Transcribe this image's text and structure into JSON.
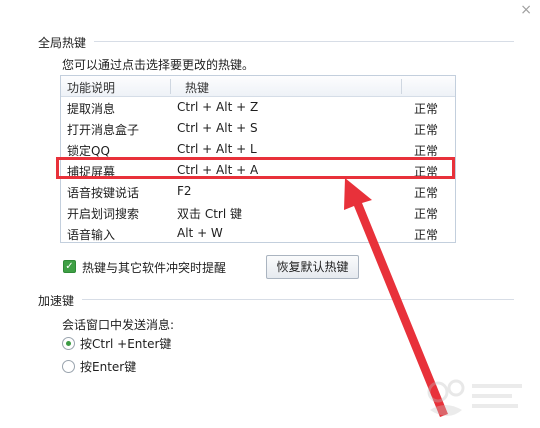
{
  "window": {
    "close_glyph": "×"
  },
  "sections": {
    "global_hotkeys": "全局热键",
    "accelerator_keys": "加速键"
  },
  "hint_text": "您可以通过点击选择要更改的热键。",
  "table": {
    "headers": [
      "功能说明",
      "热键",
      ""
    ],
    "rows": [
      {
        "name": "提取消息",
        "key": "Ctrl + Alt + Z",
        "status": "正常"
      },
      {
        "name": "打开消息盒子",
        "key": "Ctrl + Alt + S",
        "status": "正常"
      },
      {
        "name": "锁定QQ",
        "key": "Ctrl + Alt + L",
        "status": "正常"
      },
      {
        "name": "捕捉屏幕",
        "key": "Ctrl + Alt + A",
        "status": "正常"
      },
      {
        "name": "语音按键说话",
        "key": "F2",
        "status": "正常"
      },
      {
        "name": "开启划词搜索",
        "key": "双击 Ctrl 键",
        "status": "正常"
      },
      {
        "name": "语音输入",
        "key": "Alt + W",
        "status": "正常"
      }
    ],
    "highlighted_row_index": 3
  },
  "conflict_checkbox": {
    "label": "热键与其它软件冲突时提醒",
    "checked": true,
    "check_glyph": "✓"
  },
  "restore_button": "恢复默认热键",
  "send_message": {
    "label": "会话窗口中发送消息:",
    "options": [
      {
        "label": "按Ctrl +Enter键",
        "selected": true
      },
      {
        "label": "按Enter键",
        "selected": false
      }
    ]
  },
  "colors": {
    "highlight_red": "#e8313a",
    "check_green": "#3fa045"
  }
}
